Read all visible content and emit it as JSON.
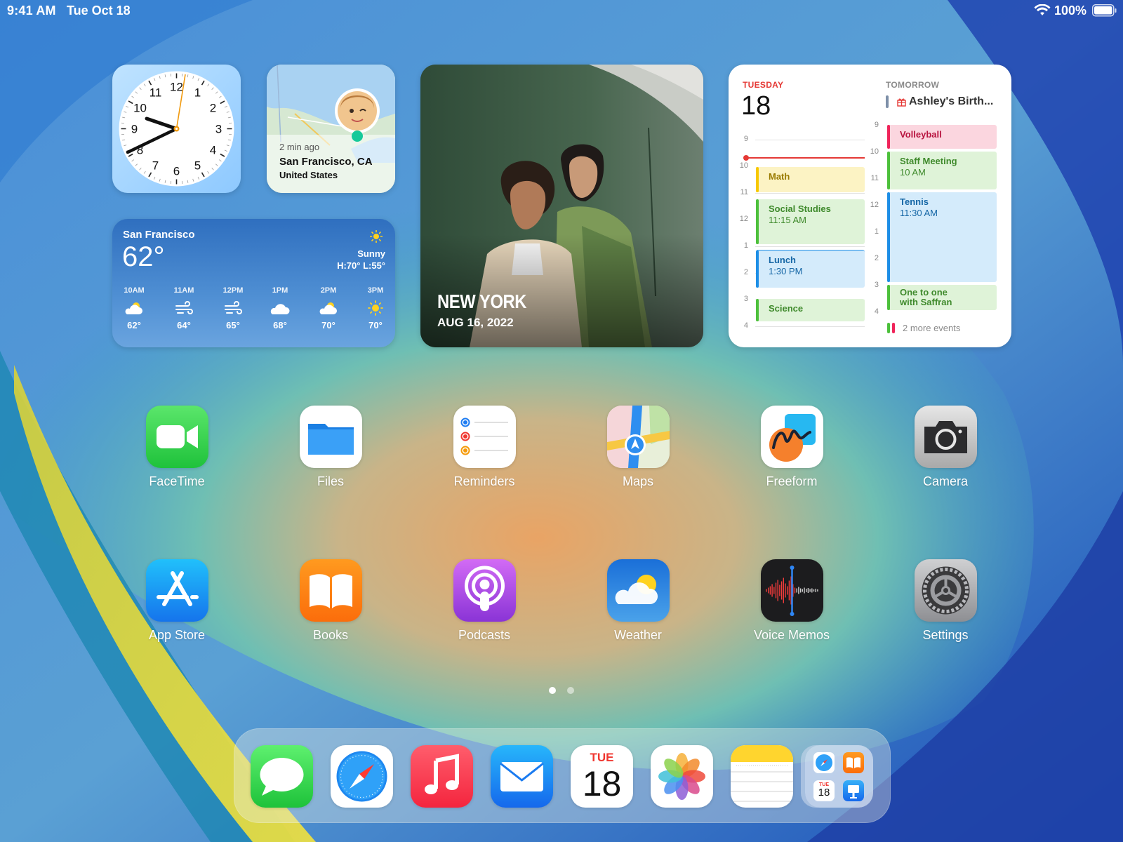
{
  "status_bar": {
    "time": "9:41 AM",
    "date": "Tue Oct 18",
    "battery": "100%"
  },
  "widgets": {
    "clock": {
      "numbers": [
        "12",
        "1",
        "2",
        "3",
        "4",
        "5",
        "6",
        "7",
        "8",
        "9",
        "10",
        "11"
      ]
    },
    "find_my": {
      "ago": "2 min ago",
      "city": "San Francisco, CA",
      "country": "United States"
    },
    "weather": {
      "city": "San Francisco",
      "temp": "62°",
      "condition": "Sunny",
      "high_low": "H:70° L:55°",
      "hours": [
        {
          "label": "10AM",
          "icon": "partly-sunny-icon",
          "temp": "62°"
        },
        {
          "label": "11AM",
          "icon": "wind-icon",
          "temp": "64°"
        },
        {
          "label": "12PM",
          "icon": "wind-icon",
          "temp": "65°"
        },
        {
          "label": "1PM",
          "icon": "cloud-icon",
          "temp": "68°"
        },
        {
          "label": "2PM",
          "icon": "partly-sunny-icon",
          "temp": "70°"
        },
        {
          "label": "3PM",
          "icon": "sun-icon",
          "temp": "70°"
        }
      ]
    },
    "photo": {
      "place": "NEW YORK",
      "date": "AUG 16, 2022"
    },
    "calendar": {
      "today_label": "TUESDAY",
      "today_date": "18",
      "tomorrow_label": "TOMORROW",
      "all_day_event": "Ashley's Birth...",
      "today_hours": [
        "9",
        "10",
        "11",
        "12",
        "1",
        "2",
        "3",
        "4"
      ],
      "tomorrow_hours": [
        "9",
        "10",
        "11",
        "12",
        "1",
        "2",
        "3",
        "4"
      ],
      "today_events": [
        {
          "title": "Math",
          "time": ""
        },
        {
          "title": "Social Studies",
          "time": "11:15 AM"
        },
        {
          "title": "Lunch",
          "time": "1:30 PM"
        },
        {
          "title": "Science",
          "time": ""
        }
      ],
      "tomorrow_events": [
        {
          "title": "Volleyball",
          "time": ""
        },
        {
          "title": "Staff Meeting",
          "time": "10 AM"
        },
        {
          "title": "Tennis",
          "time": "11:30 AM"
        },
        {
          "title": "One to one",
          "title2": "with Saffran"
        }
      ],
      "more_events": "2 more events"
    }
  },
  "apps": [
    {
      "name": "FaceTime"
    },
    {
      "name": "Files"
    },
    {
      "name": "Reminders"
    },
    {
      "name": "Maps"
    },
    {
      "name": "Freeform"
    },
    {
      "name": "Camera"
    },
    {
      "name": "App Store"
    },
    {
      "name": "Books"
    },
    {
      "name": "Podcasts"
    },
    {
      "name": "Weather"
    },
    {
      "name": "Voice Memos"
    },
    {
      "name": "Settings"
    }
  ],
  "dock": {
    "calendar_day": "TUE",
    "calendar_date": "18",
    "folder_calendar_day": "TUE",
    "folder_calendar_date": "18"
  },
  "colors": {
    "calendar_red": "#e53935",
    "math_yellow": "#f7c800",
    "green": "#4cc03b",
    "blue": "#1d8ee6",
    "pink": "#f0245a"
  }
}
